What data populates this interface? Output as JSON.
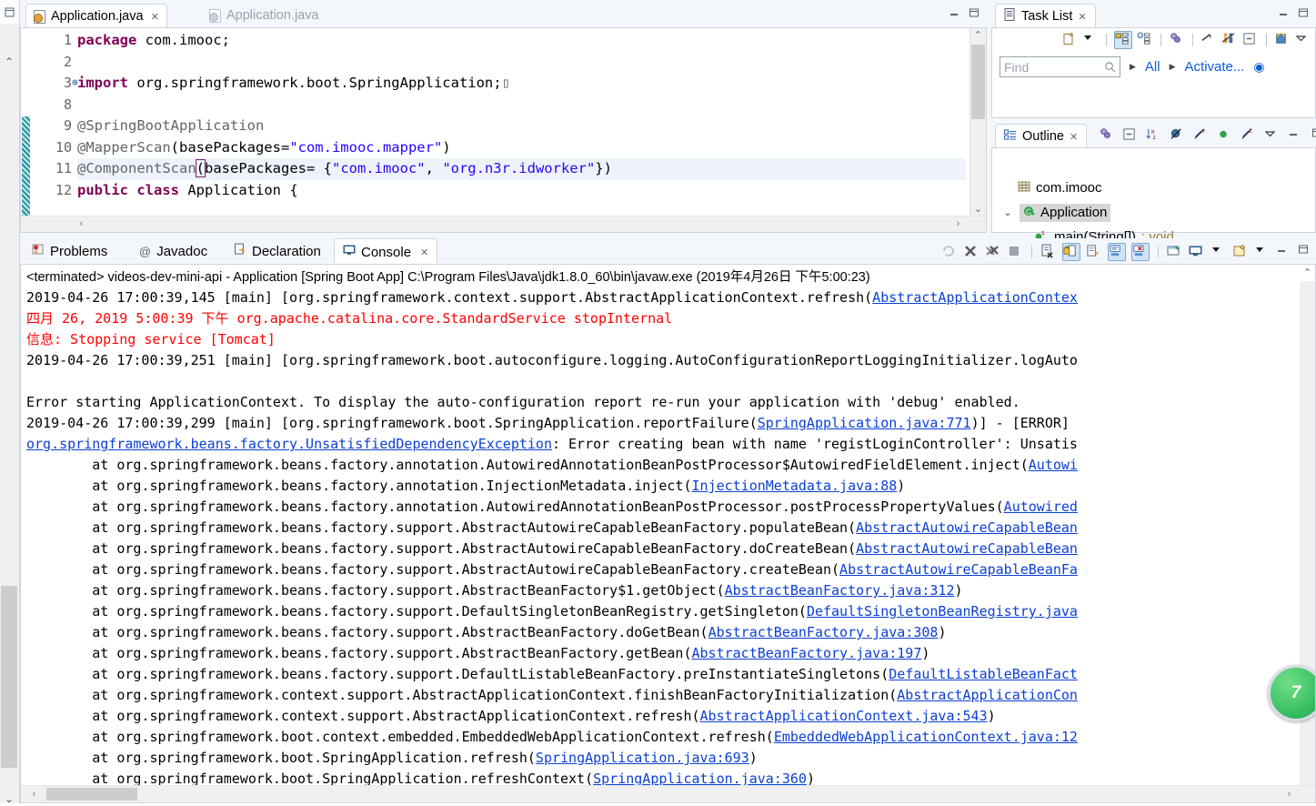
{
  "editor": {
    "tabs": [
      {
        "label": "Application.java",
        "active": true,
        "icon": "java-file-icon",
        "close": "✕"
      },
      {
        "label": "Application.java",
        "active": false,
        "icon": "java-file-icon-dim"
      }
    ],
    "line_numbers": [
      "1",
      "2",
      "3",
      "8",
      "9",
      "10",
      "11",
      "12"
    ],
    "lines": [
      {
        "no": "1",
        "segments": [
          {
            "t": "package",
            "c": "kw"
          },
          {
            "t": " com.imooc;",
            "c": "plain"
          }
        ],
        "highlight": false,
        "fold": false
      },
      {
        "no": "2",
        "segments": [
          {
            "t": "",
            "c": "plain"
          }
        ],
        "highlight": false,
        "fold": false
      },
      {
        "no": "3",
        "segments": [
          {
            "t": "import",
            "c": "kw"
          },
          {
            "t": " org.springframework.boot.SpringApplication;",
            "c": "plain"
          },
          {
            "t": "▯",
            "c": "ann"
          }
        ],
        "highlight": false,
        "fold": true
      },
      {
        "no": "8",
        "segments": [
          {
            "t": "",
            "c": "plain"
          }
        ],
        "highlight": false,
        "fold": false
      },
      {
        "no": "9",
        "segments": [
          {
            "t": "@SpringBootApplication",
            "c": "ann"
          }
        ],
        "highlight": false,
        "fold": false
      },
      {
        "no": "10",
        "segments": [
          {
            "t": "@MapperScan",
            "c": "ann"
          },
          {
            "t": "(basePackages=",
            "c": "plain"
          },
          {
            "t": "\"com.imooc.mapper\"",
            "c": "str"
          },
          {
            "t": ")",
            "c": "plain"
          }
        ],
        "highlight": false,
        "fold": false
      },
      {
        "no": "11",
        "segments": [
          {
            "t": "@ComponentScan",
            "c": "ann"
          },
          {
            "t": "(",
            "c": "brkt"
          },
          {
            "t": "basePackages= {",
            "c": "plain"
          },
          {
            "t": "\"com.imooc\"",
            "c": "str"
          },
          {
            "t": ", ",
            "c": "plain"
          },
          {
            "t": "\"org.n3r.idworker\"",
            "c": "str"
          },
          {
            "t": "})",
            "c": "plain"
          }
        ],
        "highlight": true,
        "fold": false
      },
      {
        "no": "12",
        "segments": [
          {
            "t": "public",
            "c": "kw"
          },
          {
            "t": " ",
            "c": "plain"
          },
          {
            "t": "class",
            "c": "kw"
          },
          {
            "t": " Application {",
            "c": "plain"
          }
        ],
        "highlight": false,
        "fold": false
      }
    ]
  },
  "task_list": {
    "title": "Task List",
    "close": "✕",
    "find_placeholder": "Find",
    "breadcrumbs": [
      "All",
      "Activate..."
    ],
    "toolbar_icons": [
      "new-task-icon",
      "dropdown-arrow-icon",
      "categorized-presentation-icon",
      "scheduled-presentation-icon",
      "filter-icon",
      "focus-icon",
      "people-icon",
      "collapse-all-icon",
      "synchronize-icon",
      "view-menu-icon"
    ]
  },
  "outline": {
    "title": "Outline",
    "close": "✕",
    "toolbar_icons": [
      "filter-icon",
      "collapse-all-icon",
      "sort-az-icon",
      "hide-fields-icon",
      "hide-static-icon",
      "hide-nonpublic-icon",
      "hide-local-icon",
      "view-menu-icon",
      "minimize-icon",
      "maximize-icon"
    ],
    "tree": [
      {
        "label": "com.imooc",
        "icon": "package-icon",
        "indent": 1,
        "twisty": "",
        "selected": false,
        "suffix": ""
      },
      {
        "label": "Application",
        "icon": "class-icon",
        "indent": 0,
        "twisty": "⌄",
        "selected": true,
        "suffix": ""
      },
      {
        "label": "main(String[])",
        "icon": "method-public-static-icon",
        "indent": 2,
        "twisty": "",
        "selected": false,
        "suffix": " : void"
      }
    ]
  },
  "console_tabs": [
    {
      "label": "Problems",
      "icon": "problems-icon",
      "active": false
    },
    {
      "label": "Javadoc",
      "icon": "javadoc-icon",
      "active": false
    },
    {
      "label": "Declaration",
      "icon": "declaration-icon",
      "active": false
    },
    {
      "label": "Console",
      "icon": "console-icon",
      "active": true,
      "close": "✕"
    }
  ],
  "console_toolbar_icons": [
    "relaunch-icon",
    "terminate-icon",
    "remove-all-terminated-icon",
    "stop-icon",
    "clear-console-icon",
    "scroll-lock-icon",
    "word-wrap-icon",
    "show-console-on-output-icon",
    "show-console-on-error-icon",
    "pin-console-icon",
    "display-selected-console-icon",
    "display-dropdown-icon",
    "open-console-icon",
    "open-console-dropdown-icon",
    "minimize-icon",
    "maximize-icon"
  ],
  "console": {
    "header": "<terminated> videos-dev-mini-api - Application [Spring Boot App] C:\\Program Files\\Java\\jdk1.8.0_60\\bin\\javaw.exe (2019年4月26日 下午5:00:23)",
    "lines": [
      {
        "segments": [
          {
            "t": "2019-04-26 17:00:39,145 [main] [org.springframework.context.support.AbstractApplicationContext.refresh(",
            "c": "plain"
          },
          {
            "t": "AbstractApplicationContex",
            "c": "lnk"
          }
        ]
      },
      {
        "segments": [
          {
            "t": "四月 26, 2019 5:00:39 下午 org.apache.catalina.core.StandardService stopInternal",
            "c": "red"
          }
        ]
      },
      {
        "segments": [
          {
            "t": "信息: Stopping service [Tomcat]",
            "c": "red"
          }
        ]
      },
      {
        "segments": [
          {
            "t": "2019-04-26 17:00:39,251 [main] [org.springframework.boot.autoconfigure.logging.AutoConfigurationReportLoggingInitializer.logAuto",
            "c": "plain"
          }
        ]
      },
      {
        "segments": [
          {
            "t": "",
            "c": "plain"
          }
        ]
      },
      {
        "segments": [
          {
            "t": "Error starting ApplicationContext. To display the auto-configuration report re-run your application with 'debug' enabled.",
            "c": "plain"
          }
        ]
      },
      {
        "segments": [
          {
            "t": "2019-04-26 17:00:39,299 [main] [org.springframework.boot.SpringApplication.reportFailure(",
            "c": "plain"
          },
          {
            "t": "SpringApplication.java:771",
            "c": "lnk"
          },
          {
            "t": ")] - [ERROR]",
            "c": "plain"
          }
        ]
      },
      {
        "segments": [
          {
            "t": "org.springframework.beans.factory.UnsatisfiedDependencyException",
            "c": "lnk"
          },
          {
            "t": ": Error creating bean with name 'registLoginController': Unsatis",
            "c": "plain"
          }
        ]
      },
      {
        "segments": [
          {
            "t": "        at org.springframework.beans.factory.annotation.AutowiredAnnotationBeanPostProcessor$AutowiredFieldElement.inject(",
            "c": "plain"
          },
          {
            "t": "Autowi",
            "c": "lnk"
          }
        ]
      },
      {
        "segments": [
          {
            "t": "        at org.springframework.beans.factory.annotation.InjectionMetadata.inject(",
            "c": "plain"
          },
          {
            "t": "InjectionMetadata.java:88",
            "c": "lnk"
          },
          {
            "t": ")",
            "c": "plain"
          }
        ]
      },
      {
        "segments": [
          {
            "t": "        at org.springframework.beans.factory.annotation.AutowiredAnnotationBeanPostProcessor.postProcessPropertyValues(",
            "c": "plain"
          },
          {
            "t": "Autowired",
            "c": "lnk"
          }
        ]
      },
      {
        "segments": [
          {
            "t": "        at org.springframework.beans.factory.support.AbstractAutowireCapableBeanFactory.populateBean(",
            "c": "plain"
          },
          {
            "t": "AbstractAutowireCapableBean",
            "c": "lnk"
          }
        ]
      },
      {
        "segments": [
          {
            "t": "        at org.springframework.beans.factory.support.AbstractAutowireCapableBeanFactory.doCreateBean(",
            "c": "plain"
          },
          {
            "t": "AbstractAutowireCapableBean",
            "c": "lnk"
          }
        ]
      },
      {
        "segments": [
          {
            "t": "        at org.springframework.beans.factory.support.AbstractAutowireCapableBeanFactory.createBean(",
            "c": "plain"
          },
          {
            "t": "AbstractAutowireCapableBeanFa",
            "c": "lnk"
          }
        ]
      },
      {
        "segments": [
          {
            "t": "        at org.springframework.beans.factory.support.AbstractBeanFactory$1.getObject(",
            "c": "plain"
          },
          {
            "t": "AbstractBeanFactory.java:312",
            "c": "lnk"
          },
          {
            "t": ")",
            "c": "plain"
          }
        ]
      },
      {
        "segments": [
          {
            "t": "        at org.springframework.beans.factory.support.DefaultSingletonBeanRegistry.getSingleton(",
            "c": "plain"
          },
          {
            "t": "DefaultSingletonBeanRegistry.java",
            "c": "lnk"
          }
        ]
      },
      {
        "segments": [
          {
            "t": "        at org.springframework.beans.factory.support.AbstractBeanFactory.doGetBean(",
            "c": "plain"
          },
          {
            "t": "AbstractBeanFactory.java:308",
            "c": "lnk"
          },
          {
            "t": ")",
            "c": "plain"
          }
        ]
      },
      {
        "segments": [
          {
            "t": "        at org.springframework.beans.factory.support.AbstractBeanFactory.getBean(",
            "c": "plain"
          },
          {
            "t": "AbstractBeanFactory.java:197",
            "c": "lnk"
          },
          {
            "t": ")",
            "c": "plain"
          }
        ]
      },
      {
        "segments": [
          {
            "t": "        at org.springframework.beans.factory.support.DefaultListableBeanFactory.preInstantiateSingletons(",
            "c": "plain"
          },
          {
            "t": "DefaultListableBeanFact",
            "c": "lnk"
          }
        ]
      },
      {
        "segments": [
          {
            "t": "        at org.springframework.context.support.AbstractApplicationContext.finishBeanFactoryInitialization(",
            "c": "plain"
          },
          {
            "t": "AbstractApplicationCon",
            "c": "lnk"
          }
        ]
      },
      {
        "segments": [
          {
            "t": "        at org.springframework.context.support.AbstractApplicationContext.refresh(",
            "c": "plain"
          },
          {
            "t": "AbstractApplicationContext.java:543",
            "c": "lnk"
          },
          {
            "t": ")",
            "c": "plain"
          }
        ]
      },
      {
        "segments": [
          {
            "t": "        at org.springframework.boot.context.embedded.EmbeddedWebApplicationContext.refresh(",
            "c": "plain"
          },
          {
            "t": "EmbeddedWebApplicationContext.java:12",
            "c": "lnk"
          }
        ]
      },
      {
        "segments": [
          {
            "t": "        at org.springframework.boot.SpringApplication.refresh(",
            "c": "plain"
          },
          {
            "t": "SpringApplication.java:693",
            "c": "lnk"
          },
          {
            "t": ")",
            "c": "plain"
          }
        ]
      },
      {
        "segments": [
          {
            "t": "        at org.springframework.boot.SpringApplication.refreshContext(",
            "c": "plain"
          },
          {
            "t": "SpringApplication.java:360",
            "c": "lnk"
          },
          {
            "t": ")",
            "c": "plain"
          }
        ]
      }
    ],
    "badge_text": "7"
  },
  "colors": {
    "keyword": "#7f0055",
    "string": "#2a00ff",
    "annotation": "#646464",
    "error": "#ff0000",
    "link": "#0b3fd4",
    "accent": "#0b5ed7",
    "selection": "#eef3fb"
  }
}
